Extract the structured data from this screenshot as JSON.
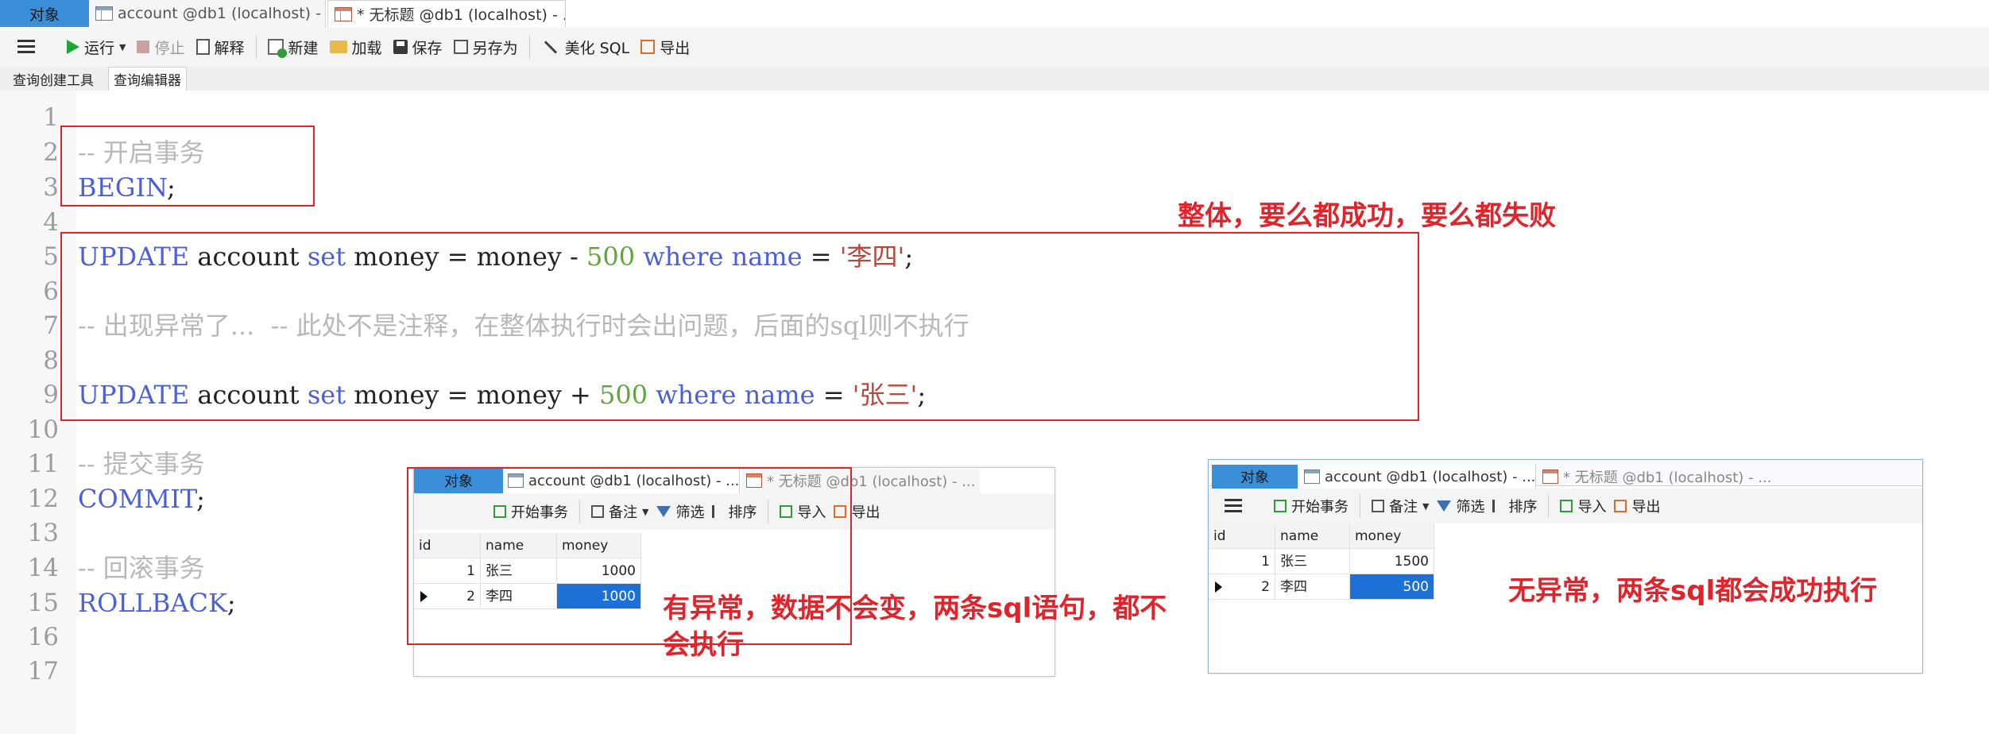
{
  "window_tabs": [
    {
      "label": "对象",
      "active": true
    },
    {
      "label": "account @db1 (localhost) - ..."
    },
    {
      "label": "* 无标题 @db1 (localhost) - ..."
    }
  ],
  "toolbar": {
    "run": "运行",
    "stop": "停止",
    "explain": "解释",
    "new": "新建",
    "load": "加载",
    "save": "保存",
    "save_as": "另存为",
    "beautify": "美化 SQL",
    "export": "导出"
  },
  "subtabs": [
    "查询创建工具",
    "查询编辑器"
  ],
  "editor": {
    "line_numbers": [
      "1",
      "2",
      "3",
      "4",
      "5",
      "6",
      "7",
      "8",
      "9",
      "10",
      "11",
      "12",
      "13",
      "14",
      "15",
      "16",
      "17"
    ],
    "line2": "-- 开启事务",
    "line3_kw": "BEGIN",
    "line3_end": ";",
    "update1": {
      "kw1": "UPDATE",
      "t1": " account ",
      "kw2": "set",
      "t2": " money = money - ",
      "num": "500",
      "t3": " ",
      "kw3": "where",
      "t4": " ",
      "kw4": "name",
      "t5": " = ",
      "str": "'李四'",
      "end": ";"
    },
    "line7": "-- 出现异常了...  -- 此处不是注释，在整体执行时会出问题，后面的sql则不执行",
    "update2": {
      "kw1": "UPDATE",
      "t1": " account ",
      "kw2": "set",
      "t2": " money = money + ",
      "num": "500",
      "t3": " ",
      "kw3": "where",
      "t4": " ",
      "kw4": "name",
      "t5": " = ",
      "str": "'张三'",
      "end": ";"
    },
    "line11": "-- 提交事务",
    "line12_kw": "COMMIT",
    "line12_end": ";",
    "line14": "-- 回滚事务",
    "line15_kw": "ROLLBACK",
    "line15_end": ";"
  },
  "annotations": {
    "whole": "整体，要么都成功，要么都失败",
    "error_case_line1": "有异常，数据不会变，两条sql语句，都不",
    "error_case_line2": "会执行",
    "ok_case": "无异常，两条sql都会成功执行"
  },
  "result_panel_common": {
    "tab_obj": "对象",
    "tab_account": "account @db1 (localhost) - ...",
    "tab_untitled": "* 无标题 @db1 (localhost) - ...",
    "begin_tx": "开始事务",
    "memo": "备注",
    "filter": "筛选",
    "sort": "排序",
    "import": "导入",
    "export": "导出",
    "columns": [
      "id",
      "name",
      "money"
    ]
  },
  "result_left": {
    "rows": [
      {
        "id": "1",
        "name": "张三",
        "money": "1000"
      },
      {
        "id": "2",
        "name": "李四",
        "money": "1000"
      }
    ]
  },
  "result_right": {
    "rows": [
      {
        "id": "1",
        "name": "张三",
        "money": "1500"
      },
      {
        "id": "2",
        "name": "李四",
        "money": "500"
      }
    ]
  },
  "colors": {
    "accent": "#3b8fd9",
    "annotation_red": "#e0242b",
    "keyword": "#4a5fd8",
    "number": "#62a53a",
    "string": "#b5483f",
    "comment": "#b8b8b8",
    "selected_cell": "#1d70d6"
  }
}
